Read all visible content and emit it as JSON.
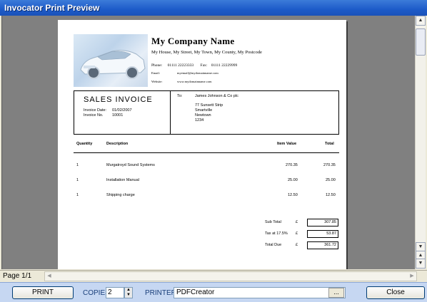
{
  "window": {
    "title": "Invocator Print Preview"
  },
  "company": {
    "name": "My Company Name",
    "address": "My House, My Street, My Town, My County, My Postcode",
    "phone_label": "Phone:",
    "phone": "01111 22223333",
    "fax_label": "Fax:",
    "fax": "01111 22229999",
    "email_label": "Email:",
    "email": "myemail@mydomainname.com",
    "website_label": "Website:",
    "website": "www.mydomainname.com"
  },
  "invoice": {
    "heading": "SALES  INVOICE",
    "date_label": "Invoice  Date:",
    "date": "01/02/2007",
    "no_label": "Invoice  No.",
    "no": "10001",
    "to_label": "To:",
    "to_lines": [
      "James  Johnson & Co plc",
      "77  Sunsett  Strip",
      "Smartville",
      "Newtown",
      "1234"
    ]
  },
  "table": {
    "headers": {
      "quantity": "Quantity",
      "description": "Description",
      "item_value": "Item Value",
      "total": "Total"
    },
    "rows": [
      {
        "qty": "1",
        "desc": "Murgatroyd  Sound  Systems",
        "value": "270.35",
        "total": "270.35"
      },
      {
        "qty": "1",
        "desc": "Installation  Manual",
        "value": "25.00",
        "total": "25.00"
      },
      {
        "qty": "1",
        "desc": "Shipping  charge",
        "value": "12.50",
        "total": "12.50"
      }
    ]
  },
  "totals": [
    {
      "label": "Sub  Total",
      "currency": "£",
      "amount": "307.85"
    },
    {
      "label": "Tax  at  17.5%",
      "currency": "£",
      "amount": "53.87"
    },
    {
      "label": "Total  Due",
      "currency": "£",
      "amount": "361.72"
    }
  ],
  "status": {
    "page": "Page 1/1"
  },
  "toolbar": {
    "print_label": "PRINT",
    "copies_label": "COPIES",
    "copies_value": "2",
    "printer_label": "PRINTER",
    "printer_value": "PDFCreator",
    "browse_label": "...",
    "close_label": "Close"
  }
}
